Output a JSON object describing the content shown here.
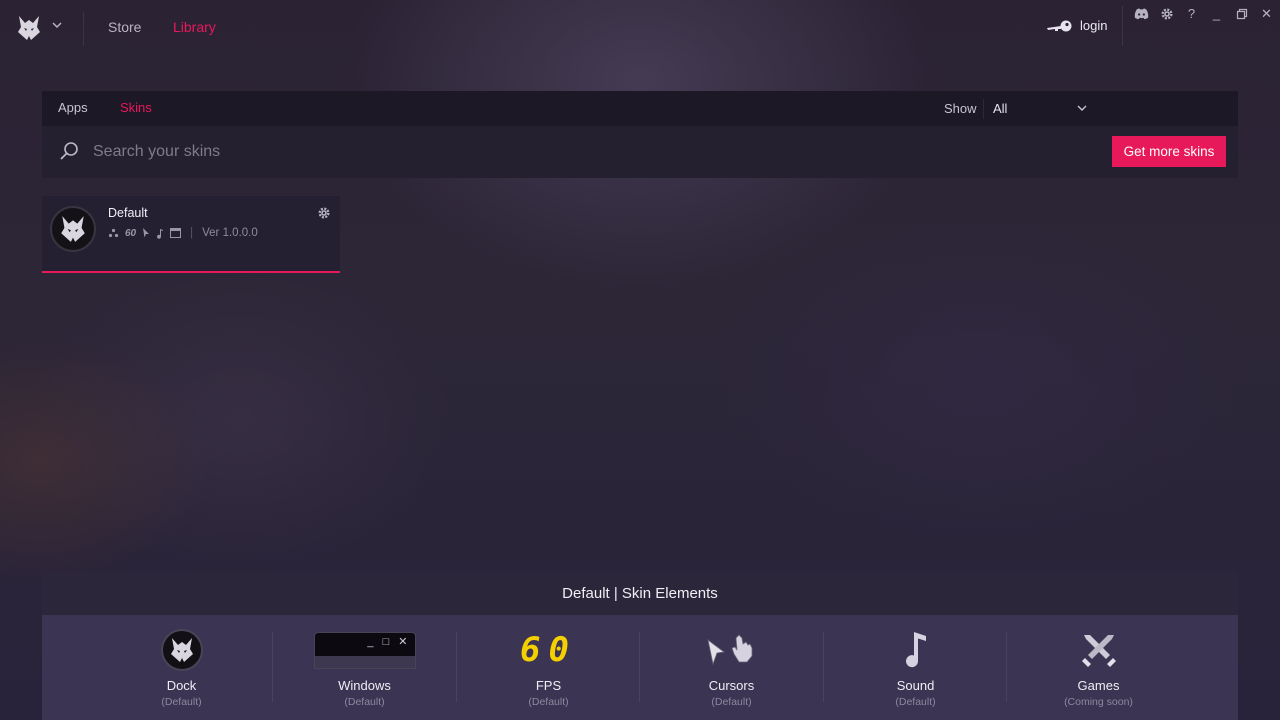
{
  "nav": {
    "store": "Store",
    "library": "Library"
  },
  "account": {
    "login_label": "login"
  },
  "window_controls": {
    "help": "?",
    "minimize": "_",
    "close": "✕"
  },
  "tabs": {
    "apps": "Apps",
    "skins": "Skins"
  },
  "filter": {
    "show_label": "Show",
    "selected": "All"
  },
  "search": {
    "placeholder": "Search your skins",
    "value": ""
  },
  "actions": {
    "get_more_skins": "Get more skins"
  },
  "skins": [
    {
      "name": "Default",
      "fps_badge": "60",
      "version": "Ver 1.0.0.0"
    }
  ],
  "elements_section": {
    "title": "Default | Skin Elements",
    "fps_preview": "60",
    "windows_preview_buttons": "_ □ ✕",
    "items": [
      {
        "name": "Dock",
        "status": "(Default)"
      },
      {
        "name": "Windows",
        "status": "(Default)"
      },
      {
        "name": "FPS",
        "status": "(Default)"
      },
      {
        "name": "Cursors",
        "status": "(Default)"
      },
      {
        "name": "Sound",
        "status": "(Default)"
      },
      {
        "name": "Games",
        "status": "(Coming soon)"
      }
    ]
  },
  "colors": {
    "accent": "#e8195a",
    "fps_yellow": "#f5d000",
    "panel": "#3b3452",
    "bar": "#1c1826"
  },
  "icons": [
    "wolf-logo-icon",
    "chevron-down-icon",
    "key-icon",
    "discord-icon",
    "gear-icon",
    "help-icon",
    "minimize-icon",
    "restore-icon",
    "close-icon",
    "search-icon",
    "dock-icon",
    "windows-icon",
    "cursor-icon",
    "sound-icon",
    "games-icon"
  ]
}
